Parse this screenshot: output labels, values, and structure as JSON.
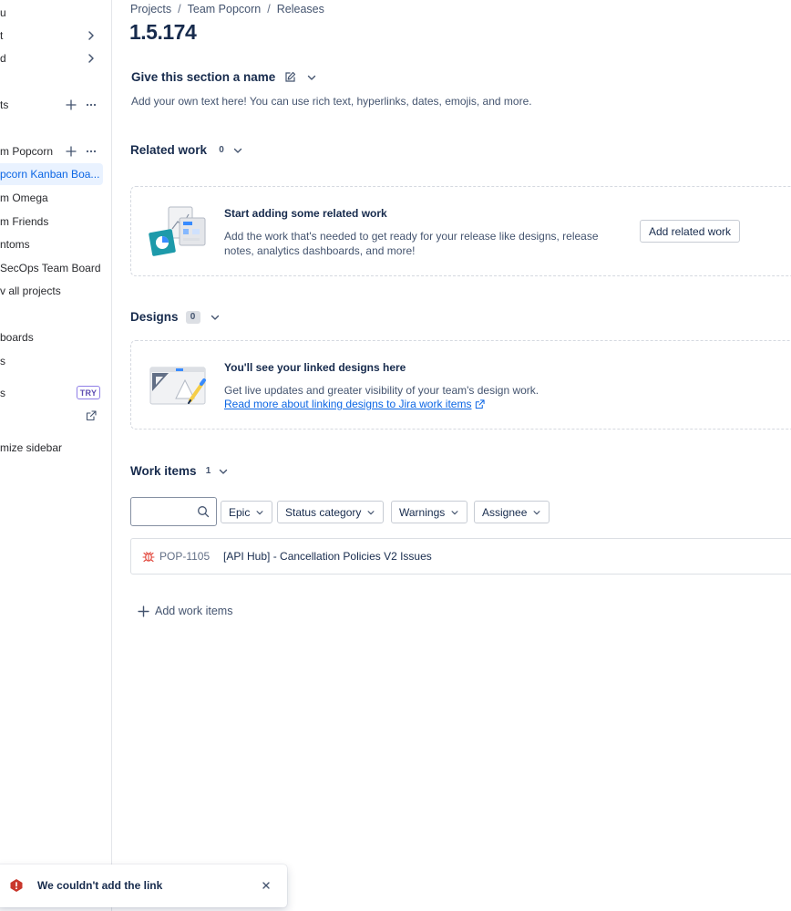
{
  "sidebar": {
    "items": [
      {
        "label": "u"
      },
      {
        "label": "t"
      },
      {
        "label": "d"
      },
      {
        "label": "ts"
      },
      {
        "label": "m Popcorn"
      },
      {
        "label": "pcorn Kanban Boa..."
      },
      {
        "label": "m Omega"
      },
      {
        "label": "m Friends"
      },
      {
        "label": "ntoms"
      },
      {
        "label": "SecOps Team Board"
      },
      {
        "label": "v all projects"
      },
      {
        "label": "boards"
      },
      {
        "label": "s"
      },
      {
        "label": "s"
      },
      {
        "label": "mize sidebar"
      }
    ],
    "try_badge": "TRY"
  },
  "breadcrumb": {
    "items": [
      "Projects",
      "Team Popcorn",
      "Releases"
    ],
    "separator": "/"
  },
  "page_title": "1.5.174",
  "custom_section": {
    "title": "Give this section a name",
    "description": "Add your own text here! You can use rich text, hyperlinks, dates, emojis, and more."
  },
  "related_work": {
    "title": "Related work",
    "count": "0",
    "empty_heading": "Start adding some related work",
    "empty_text_line1": "Add the work that's needed to get ready for your release like designs, release",
    "empty_text_line2": "notes, analytics dashboards, and more!",
    "button": "Add related work"
  },
  "designs": {
    "title": "Designs",
    "count": "0",
    "empty_heading": "You'll see your linked designs here",
    "empty_text": "Get live updates and greater visibility of your team's design work.",
    "link": "Read more about linking designs to Jira work items"
  },
  "work_items": {
    "title": "Work items",
    "count": "1",
    "search_placeholder": "",
    "filters": [
      "Epic",
      "Status category",
      "Warnings",
      "Assignee"
    ],
    "rows": [
      {
        "key": "POP-1105",
        "summary": "[API Hub] - Cancellation Policies V2 Issues",
        "type_icon": "bug-icon"
      }
    ],
    "add_label": "Add work items"
  },
  "toast": {
    "message": "We couldn't add the link",
    "icon": "error-icon"
  },
  "colors": {
    "accent": "#0c66e4",
    "selected_bg": "#e9f2ff",
    "error": "#c9372c",
    "bug": "#e2483d",
    "try_border": "#8f7ee7"
  }
}
